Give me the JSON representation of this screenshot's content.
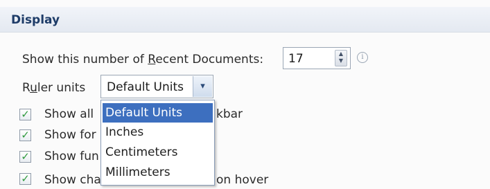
{
  "section": {
    "title": "Display"
  },
  "recent_docs": {
    "label_before": "Show this number of ",
    "label_underline": "R",
    "label_after": "ecent Documents:",
    "value": "17",
    "spin_up": "▲",
    "spin_down": "▼",
    "info": "i"
  },
  "ruler": {
    "label_before": "R",
    "label_underline": "u",
    "label_after": "ler units",
    "selected": "Default Units",
    "arrow": "▾",
    "options": [
      "Default Units",
      "Inches",
      "Centimeters",
      "Millimeters"
    ]
  },
  "checkboxes": [
    {
      "visible_left": "Show all",
      "visible_right": "kbar",
      "checked": true
    },
    {
      "visible_left": "Show for",
      "visible_right": "",
      "checked": true
    },
    {
      "visible_left": "Show fun",
      "visible_right": "",
      "checked": true
    },
    {
      "visible_left": "Show cha",
      "visible_right": "on hover",
      "checked": true
    }
  ],
  "check_glyph": "✓",
  "colors": {
    "header_text": "#1e3c68",
    "selection": "#3d6fbf",
    "checkmark": "#2f9a3d"
  }
}
